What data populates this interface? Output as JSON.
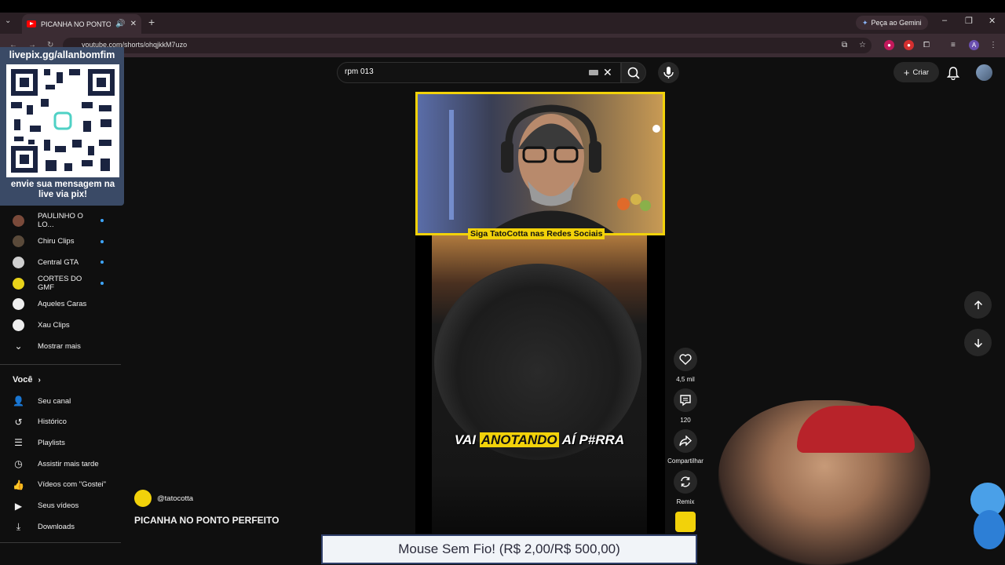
{
  "browser": {
    "tab_title": "PICANHA NO PONTO PERFEITO",
    "url": "youtube.com/shorts/ohqjkkM7uzo",
    "gemini_button": "Peça ao Gemini",
    "profile_letter": "A"
  },
  "overlay_qr": {
    "url": "livepix.gg/allanbomfim",
    "caption_line1": "envie sua mensagem na",
    "caption_line2": "live via pix!"
  },
  "sidebar": {
    "subscriptions": [
      {
        "label": "PAULINHO O LO...",
        "avatar_color": "#7a4a3a"
      },
      {
        "label": "Chiru Clips",
        "avatar_color": "#5a4a3a"
      },
      {
        "label": "Central GTA",
        "avatar_color": "#cfcfcf"
      },
      {
        "label": "CORTES DO GMF",
        "avatar_color": "#e8d21a"
      },
      {
        "label": "Aqueles Caras",
        "avatar_color": "#eeeeee"
      },
      {
        "label": "Xau Clips",
        "avatar_color": "#eeeeee"
      }
    ],
    "show_more": "Mostrar mais",
    "you_section": "Você",
    "you_items": [
      {
        "label": "Seu canal",
        "icon": "channel-icon"
      },
      {
        "label": "Histórico",
        "icon": "history-icon"
      },
      {
        "label": "Playlists",
        "icon": "playlist-icon"
      },
      {
        "label": "Assistir mais tarde",
        "icon": "watch-later-icon"
      },
      {
        "label": "Vídeos com \"Gostei\"",
        "icon": "thumbs-up-icon"
      },
      {
        "label": "Seus vídeos",
        "icon": "video-icon"
      },
      {
        "label": "Downloads",
        "icon": "download-icon"
      }
    ]
  },
  "header": {
    "search_value": "rpm 013",
    "create_label": "Criar"
  },
  "video": {
    "banner_text": "Siga TatoCotta nas Redes Sociais",
    "caption_pre": "VAI ",
    "caption_hl": "ANOTANDO",
    "caption_post": " AÍ P#RRA"
  },
  "actions": {
    "likes": "4,5 mil",
    "comments": "120",
    "share": "Compartilhar",
    "remix": "Remix"
  },
  "channel": {
    "handle": "@tatocotta",
    "title": "PICANHA NO PONTO PERFEITO"
  },
  "donation": {
    "text": "Mouse Sem Fio! (R$ 2,00/R$ 500,00)"
  }
}
